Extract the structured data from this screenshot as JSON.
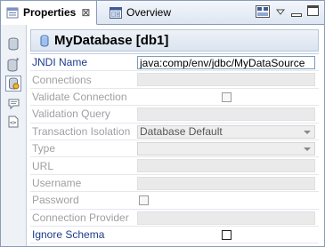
{
  "tabs": [
    {
      "label": "Properties",
      "close": "⊠"
    },
    {
      "label": "Overview"
    }
  ],
  "title": "MyDatabase [db1]",
  "properties": [
    {
      "label": "JNDI Name",
      "value": "java:comp/env/jdbc/MyDataSource",
      "kind": "text",
      "enabled": true
    },
    {
      "label": "Connections",
      "value": "",
      "kind": "empty",
      "enabled": false
    },
    {
      "label": "Validate Connection",
      "value": "",
      "kind": "checkbox-center",
      "enabled": false,
      "checked": false
    },
    {
      "label": "Validation Query",
      "value": "",
      "kind": "empty",
      "enabled": false
    },
    {
      "label": "Transaction Isolation",
      "value": "Database Default",
      "kind": "combo",
      "enabled": false
    },
    {
      "label": "Type",
      "value": "",
      "kind": "combo",
      "enabled": false
    },
    {
      "label": "URL",
      "value": "",
      "kind": "empty",
      "enabled": false
    },
    {
      "label": "Username",
      "value": "",
      "kind": "empty",
      "enabled": false
    },
    {
      "label": "Password",
      "value": "",
      "kind": "checkbox-left",
      "enabled": false,
      "checked": false
    },
    {
      "label": "Connection Provider",
      "value": "",
      "kind": "empty",
      "enabled": false
    },
    {
      "label": "Ignore Schema",
      "value": "",
      "kind": "checkbox-center",
      "enabled": true,
      "checked": false
    }
  ]
}
